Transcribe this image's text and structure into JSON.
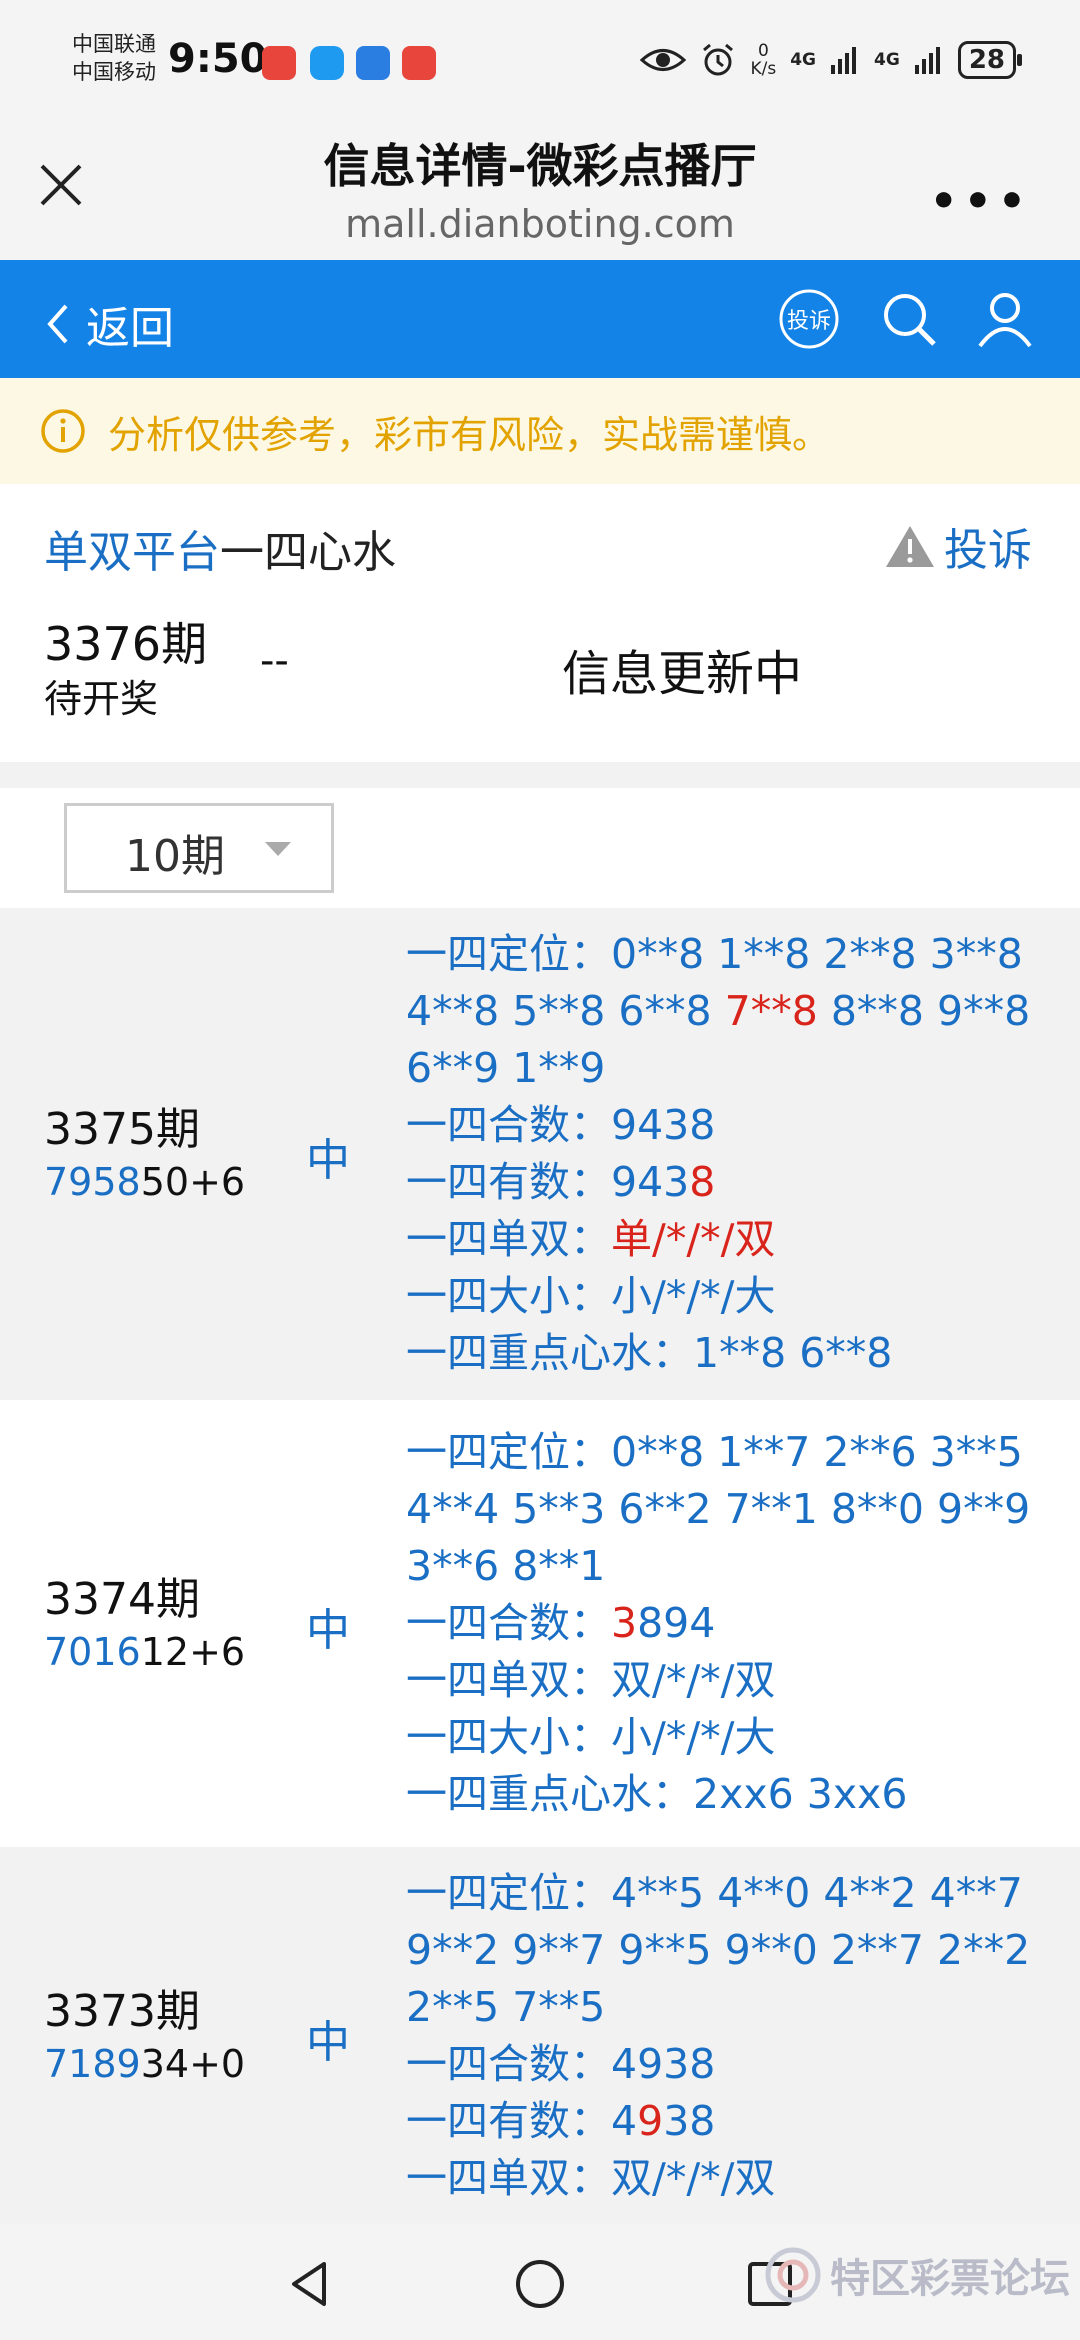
{
  "status_bar": {
    "carrier_1": "中国联通",
    "carrier_2": "中国移动",
    "time": "9:50",
    "net_speed_value": "0",
    "net_speed_unit": "K/s",
    "network_1": "4G",
    "network_2": "4G",
    "battery": "28"
  },
  "browser": {
    "title": "信息详情-微彩点播厅",
    "url": "mall.dianboting.com",
    "more": "•••"
  },
  "navbar": {
    "back_label": "返回",
    "report_badge": "投诉"
  },
  "notice": {
    "text": "分析仅供参考，彩市有风险，实战需谨慎。"
  },
  "plan": {
    "title_blue": "单双平台",
    "title_dark": "一四心水",
    "complain_label": "投诉"
  },
  "current_issue": {
    "period": "3376期",
    "status": "待开奖",
    "result": "--",
    "info": "信息更新中"
  },
  "filter": {
    "selected": "10期"
  },
  "records": [
    {
      "period": "3375期",
      "result_highlight": "7958",
      "result_rest": "50+6",
      "hit": "中",
      "lines": [
        {
          "label": "一四定位：",
          "parts": [
            {
              "t": "0**8 1**8 2**8 3**8 4**8 5**8 6**8 "
            },
            {
              "t": "7**8",
              "red": true
            },
            {
              "t": " 8**8 9**8 6**9 1**9"
            }
          ]
        },
        {
          "label": "一四合数：",
          "parts": [
            {
              "t": "9438"
            }
          ]
        },
        {
          "label": "一四有数：",
          "parts": [
            {
              "t": "943"
            },
            {
              "t": "8",
              "red": true
            }
          ]
        },
        {
          "label": "一四单双：",
          "parts": [
            {
              "t": "单/*/*/双",
              "red": true
            }
          ]
        },
        {
          "label": "一四大小：",
          "parts": [
            {
              "t": "小/*/*/大"
            }
          ]
        },
        {
          "label": "一四重点心水：",
          "parts": [
            {
              "t": "1**8 6**8"
            }
          ]
        }
      ]
    },
    {
      "period": "3374期",
      "result_highlight": "7016",
      "result_rest": "12+6",
      "hit": "中",
      "lines": [
        {
          "label": "一四定位：",
          "parts": [
            {
              "t": "0**8 1**7 2**6 3**5 4**4 5**3 6**2 7**1 8**0 9**9 3**6 8**1"
            }
          ]
        },
        {
          "label": "一四合数：",
          "parts": [
            {
              "t": "3",
              "red": true
            },
            {
              "t": "894"
            }
          ]
        },
        {
          "label": "一四单双：",
          "parts": [
            {
              "t": "双/*/*/双"
            }
          ]
        },
        {
          "label": "一四大小：",
          "parts": [
            {
              "t": "小/*/*/大"
            }
          ]
        },
        {
          "label": "一四重点心水：",
          "parts": [
            {
              "t": "2xx6 3xx6"
            }
          ]
        }
      ]
    },
    {
      "period": "3373期",
      "result_highlight": "7189",
      "result_rest": "34+0",
      "hit": "中",
      "lines": [
        {
          "label": "一四定位：",
          "parts": [
            {
              "t": "4**5 4**0 4**2 4**7 9**2 9**7 9**5 9**0 2**7 2**2 2**5 7**5"
            }
          ]
        },
        {
          "label": "一四合数：",
          "parts": [
            {
              "t": "4938"
            }
          ]
        },
        {
          "label": "一四有数：",
          "parts": [
            {
              "t": "4"
            },
            {
              "t": "9",
              "red": true
            },
            {
              "t": "38"
            }
          ]
        },
        {
          "label": "一四单双：",
          "parts": [
            {
              "t": "双/*/*/双"
            }
          ]
        }
      ]
    }
  ],
  "watermark": {
    "text": "特区彩票论坛"
  },
  "colors": {
    "accent_blue": "#1383e8",
    "link_blue": "#1a6fc4",
    "highlight_red": "#d9241c",
    "notice_bg": "#fdf8e4",
    "notice_text": "#e2a300"
  }
}
